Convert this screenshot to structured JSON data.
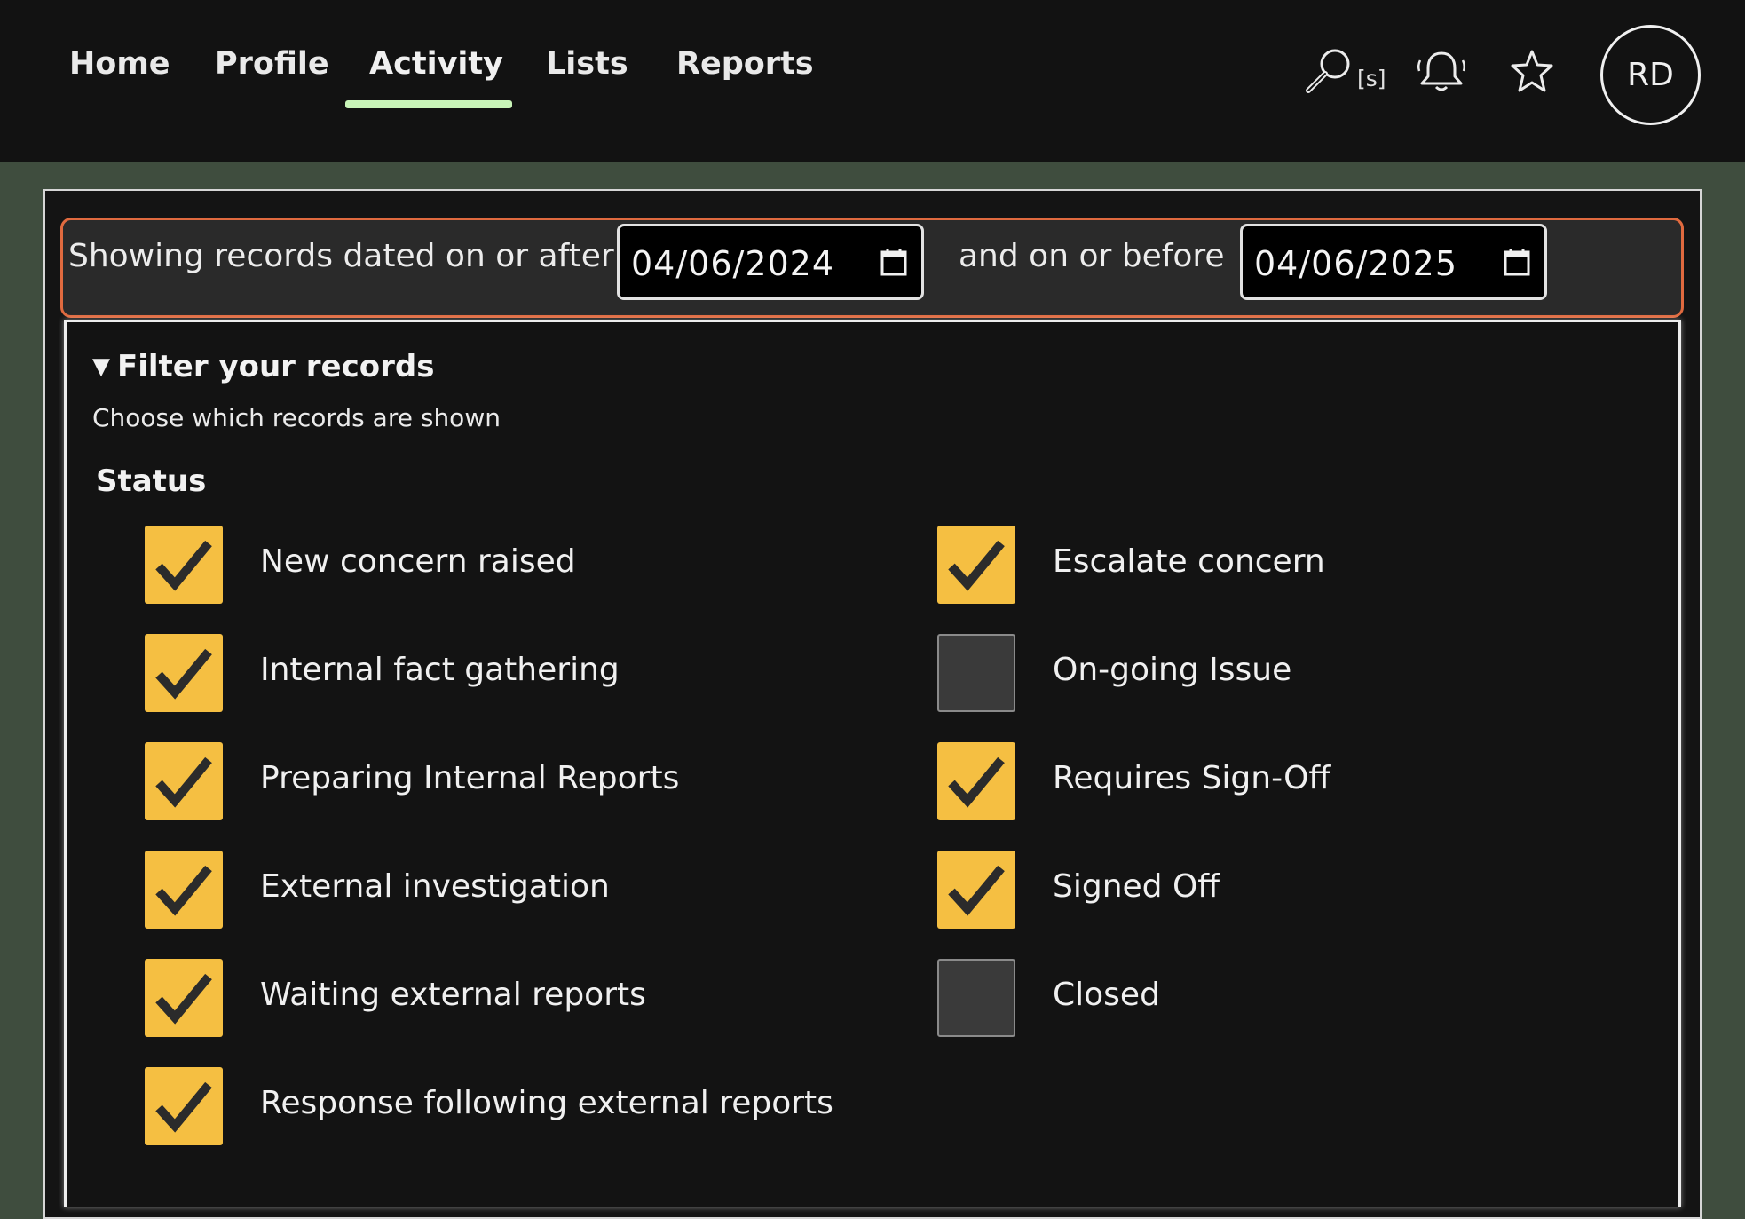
{
  "nav": {
    "items": [
      {
        "label": "Home"
      },
      {
        "label": "Profile"
      },
      {
        "label": "Activity"
      },
      {
        "label": "Lists"
      },
      {
        "label": "Reports"
      }
    ],
    "active": "Activity"
  },
  "header": {
    "search_shortcut": "[s]",
    "avatar_initials": "RD",
    "icons": [
      "search-icon",
      "bell-icon",
      "star-icon"
    ]
  },
  "date_filter": {
    "after_label": "Showing records dated on or after",
    "after_value": "04/06/2024",
    "before_label": "and on or before",
    "before_value": "04/06/2025"
  },
  "filter": {
    "summary": "Filter your records",
    "subtitle": "Choose which records are shown",
    "status_heading": "Status",
    "statuses": [
      {
        "label": "New concern raised",
        "checked": true
      },
      {
        "label": "Internal fact gathering",
        "checked": true
      },
      {
        "label": "Preparing Internal Reports",
        "checked": true
      },
      {
        "label": "External investigation",
        "checked": true
      },
      {
        "label": "Waiting external reports",
        "checked": true
      },
      {
        "label": "Response following external reports",
        "checked": true
      },
      {
        "label": "Escalate concern",
        "checked": true
      },
      {
        "label": "On-going Issue",
        "checked": false
      },
      {
        "label": "Requires Sign-Off",
        "checked": true
      },
      {
        "label": "Signed Off",
        "checked": true
      },
      {
        "label": "Closed",
        "checked": false
      }
    ]
  },
  "colors": {
    "checkbox_on": "#f5bf42",
    "checkbox_off": "#3a3a3a",
    "active_tab_underline": "#c8f4b8",
    "date_bar_border": "#e06a3f",
    "page_background": "#3f4d3e"
  }
}
